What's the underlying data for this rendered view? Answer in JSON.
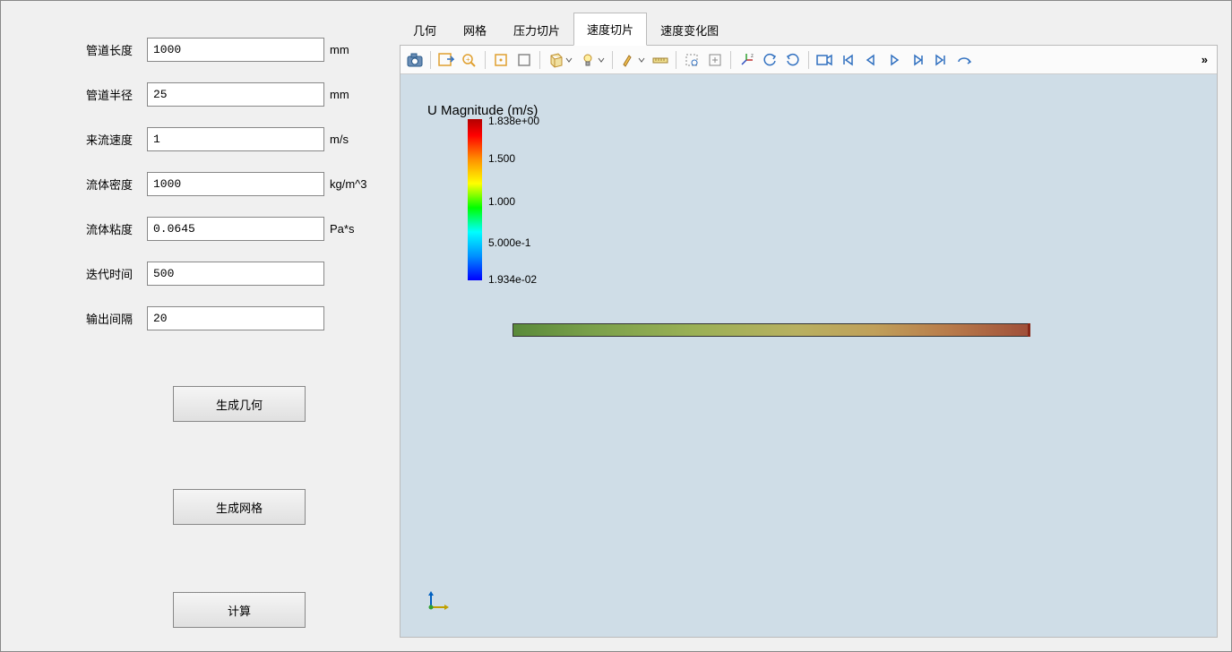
{
  "form": {
    "pipe_length": {
      "label": "管道长度",
      "value": "1000",
      "unit": "mm"
    },
    "pipe_radius": {
      "label": "管道半径",
      "value": "25",
      "unit": "mm"
    },
    "inflow_velocity": {
      "label": "来流速度",
      "value": "1",
      "unit": "m/s"
    },
    "fluid_density": {
      "label": "流体密度",
      "value": "1000",
      "unit": "kg/m^3"
    },
    "fluid_viscosity": {
      "label": "流体粘度",
      "value": "0.0645",
      "unit": "Pa*s"
    },
    "iteration_time": {
      "label": "迭代时间",
      "value": "500",
      "unit": ""
    },
    "output_interval": {
      "label": "输出间隔",
      "value": "20",
      "unit": ""
    }
  },
  "buttons": {
    "generate_geometry": "生成几何",
    "generate_mesh": "生成网格",
    "compute": "计算"
  },
  "tabs": {
    "geometry": "几何",
    "mesh": "网格",
    "pressure_slice": "压力切片",
    "velocity_slice": "速度切片",
    "velocity_plot": "速度变化图",
    "active": "velocity_slice"
  },
  "legend": {
    "title": "U Magnitude (m/s)",
    "ticks": [
      "1.838e+00",
      "1.500",
      "1.000",
      "5.000e-1",
      "1.934e-02"
    ]
  },
  "toolbar": {
    "more": "»"
  }
}
